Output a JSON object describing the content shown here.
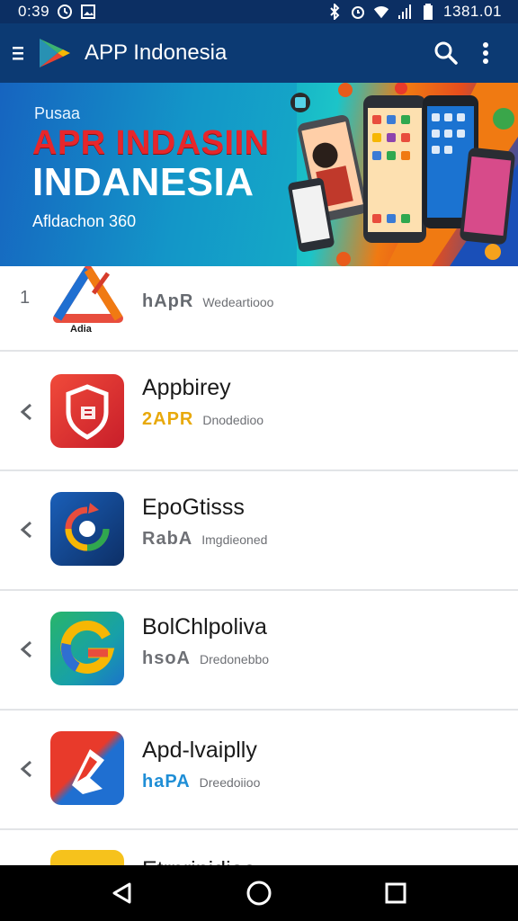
{
  "status_bar": {
    "time": "0:39",
    "right_text": "1381.01",
    "icons": [
      "clock-icon",
      "image-icon",
      "bluetooth-icon",
      "alarm-icon",
      "wifi-icon",
      "signal-icon",
      "battery-icon"
    ]
  },
  "app_bar": {
    "title": "APP Indonesia",
    "icons": [
      "menu-icon",
      "play-store-logo-icon",
      "search-icon",
      "more-vertical-icon"
    ]
  },
  "banner": {
    "kicker": "Pusaa",
    "headline_red": "APR INDASIIN",
    "headline_white": "INDANESIA",
    "subtitle": "Afldachon 360"
  },
  "apps": [
    {
      "rank": "1",
      "name": "",
      "badge": "hApR",
      "badge_color": "#666a70",
      "desc": "Wedeartiooo",
      "icon": "triangle-logo-icon",
      "icon_caption": "Adia"
    },
    {
      "name": "Appbirey",
      "badge": "2APR",
      "badge_color": "#e8a90c",
      "desc": "Dnodedioo",
      "icon": "shield-icon"
    },
    {
      "name": "EpoGtisss",
      "badge": "RabA",
      "badge_color": "#6e7075",
      "desc": "Imgdieoned",
      "icon": "refresh-g-icon"
    },
    {
      "name": "BolChlpoliva",
      "badge": "hsoA",
      "badge_color": "#6e7075",
      "desc": "Dredonebbo",
      "icon": "g-logo-icon"
    },
    {
      "name": "Apd-lvaiplly",
      "badge": "haPA",
      "badge_color": "#1f8ed6",
      "desc": "Dreedoiioo",
      "icon": "red-arrow-icon"
    },
    {
      "name": "Etrnrinidiae",
      "icon": "yellow-app-icon"
    }
  ],
  "nav_bar": {
    "icons": [
      "back-icon",
      "home-icon",
      "recents-icon"
    ]
  },
  "colors": {
    "status_bar": "#0c2f63",
    "app_bar": "#0c3a73",
    "divider": "#e2e4e7",
    "nav_bar": "#000000"
  }
}
